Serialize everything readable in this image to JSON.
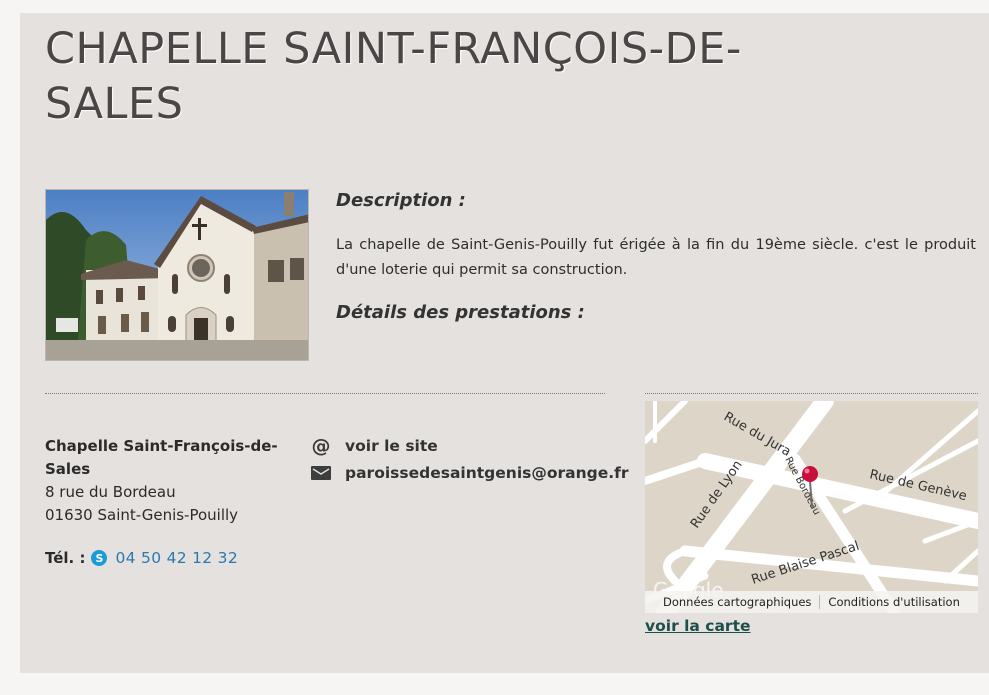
{
  "page": {
    "title": "CHAPELLE SAINT-FRANÇOIS-DE-SALES"
  },
  "description": {
    "heading": "Description :",
    "text": "La chapelle de Saint-Genis-Pouilly fut érigée à la fin du 19ème siècle. c'est le produit d'une loterie qui permit sa construction."
  },
  "services": {
    "heading": "Détails des prestations :"
  },
  "address": {
    "name": "Chapelle Saint-François-de-Sales",
    "street": "8 rue du Bordeau",
    "city": "01630 Saint-Genis-Pouilly"
  },
  "phone": {
    "label": "Tél. :",
    "icon": "skype-icon",
    "number": "04 50 42 12 32"
  },
  "links": {
    "website_label": "voir le site",
    "website_icon": "at-icon",
    "email": "paroissedesaintgenis@orange.fr",
    "email_icon": "envelope-icon"
  },
  "map": {
    "streets": [
      "Rue du Jura",
      "Rue de Lyon",
      "Rue Bordeau",
      "Rue de Genève",
      "Rue Blaise Pascal"
    ],
    "watermark": "Google",
    "footer_data": "Données cartographiques",
    "footer_terms": "Conditions d'utilisation",
    "link_label": "voir la carte"
  },
  "colors": {
    "background": "#e4e1de",
    "link": "#2a7ab0",
    "map_link": "#1d4f4a",
    "pin": "#c8103c"
  }
}
